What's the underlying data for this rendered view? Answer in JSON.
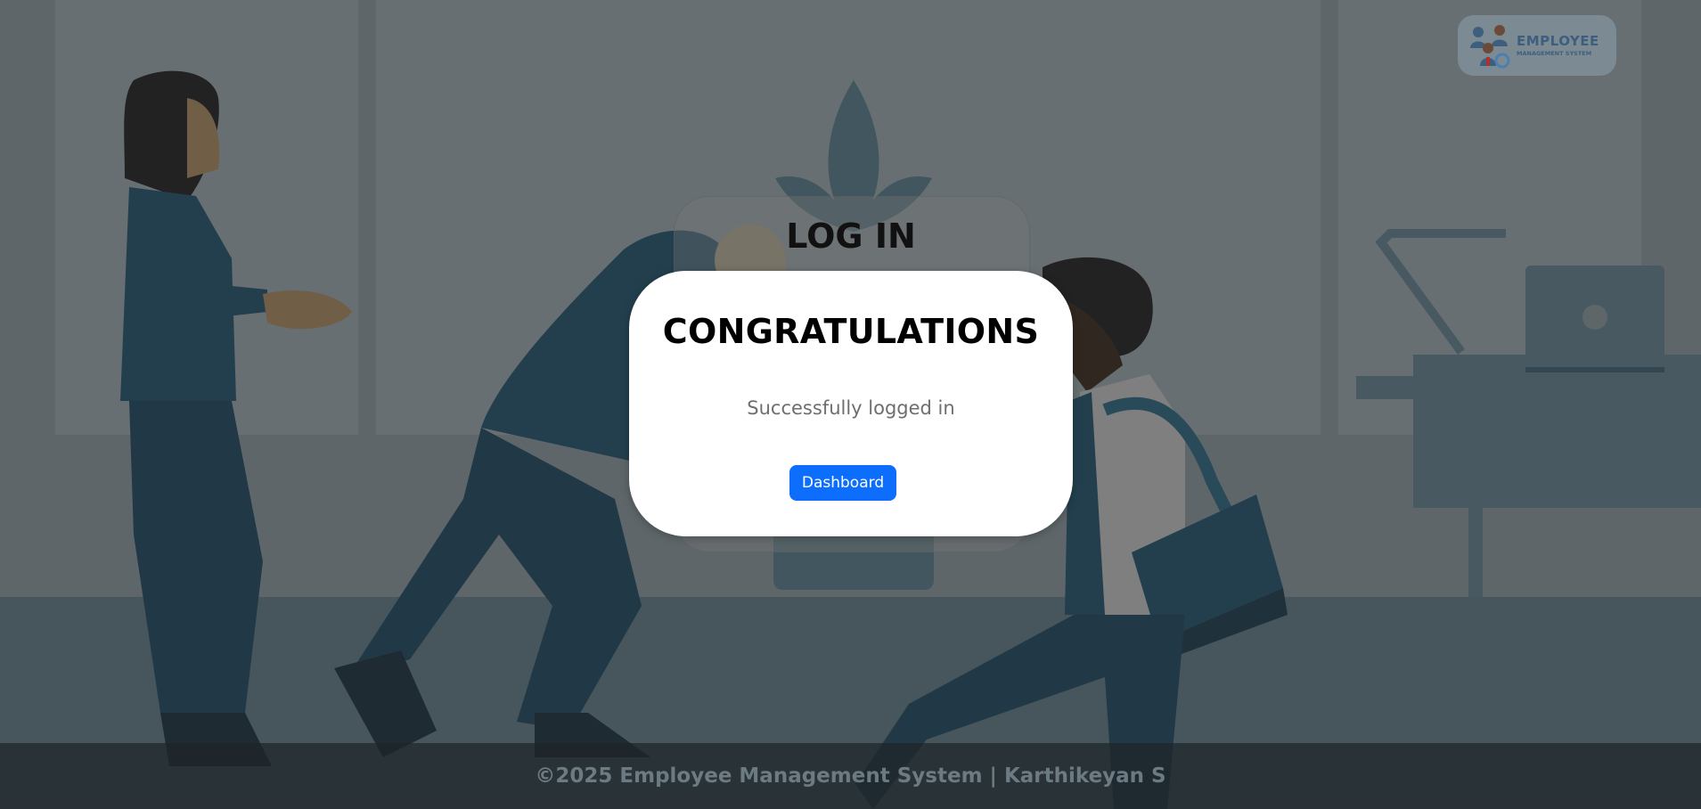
{
  "header": {
    "logo": {
      "title": "EMPLOYEE",
      "subtitle": "MANAGEMENT SYSTEM"
    }
  },
  "login_panel": {
    "title": "LOG IN"
  },
  "modal": {
    "title": "CONGRATULATIONS",
    "message": "Successfully logged in",
    "button_label": "Dashboard"
  },
  "footer": {
    "text": "©2025 Employee Management System | Karthikeyan S"
  },
  "colors": {
    "accent_button": "#0d6efd",
    "overlay": "#282828",
    "modal_bg": "#ffffff"
  }
}
